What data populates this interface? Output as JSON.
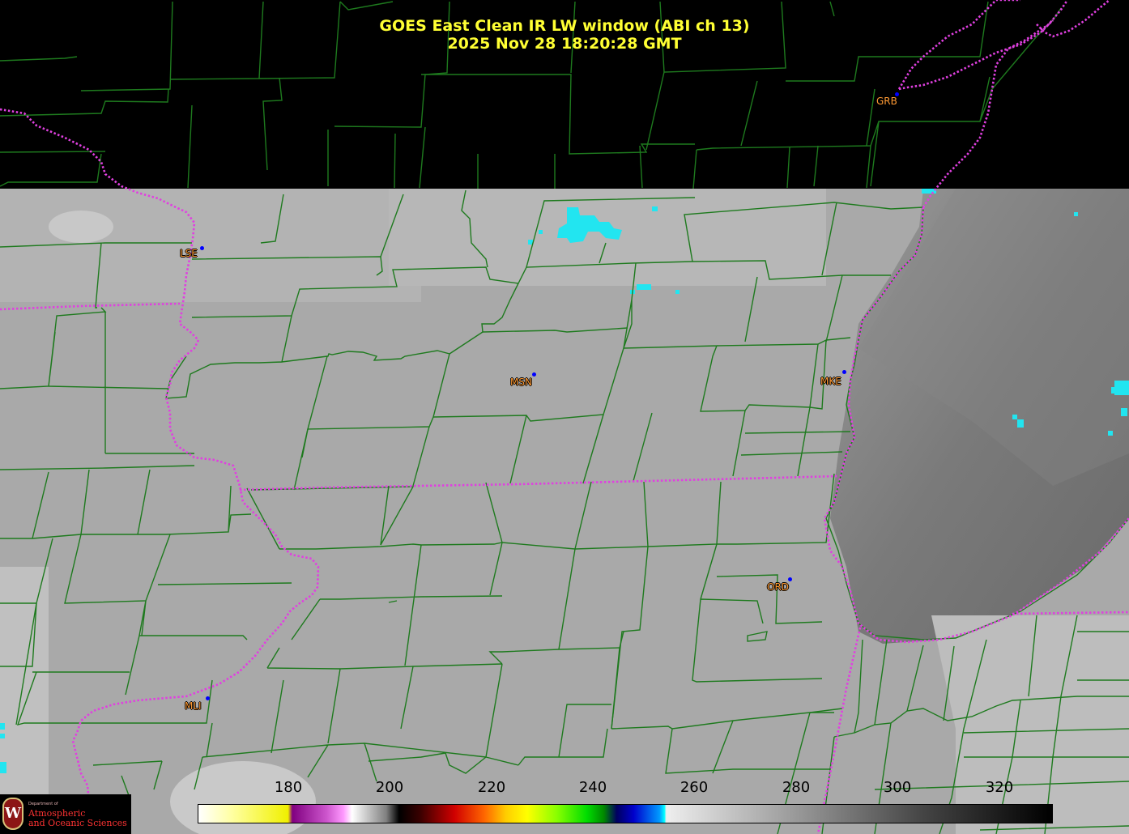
{
  "title": {
    "line1": "GOES East Clean IR LW window (ABI ch 13)",
    "line2": "2025 Nov 28  18:20:28 GMT"
  },
  "cities": [
    {
      "id": "GRB",
      "label": "GRB"
    },
    {
      "id": "LSE",
      "label": "LSE"
    },
    {
      "id": "MSN",
      "label": "MSN"
    },
    {
      "id": "MKE",
      "label": "MKE"
    },
    {
      "id": "ORD",
      "label": "ORD"
    },
    {
      "id": "MLI",
      "label": "MLI"
    }
  ],
  "colorbar": {
    "ticks": [
      "180",
      "200",
      "220",
      "240",
      "260",
      "280",
      "300",
      "320"
    ],
    "range": [
      163,
      330
    ]
  },
  "logo": {
    "small": "Department of",
    "line1": "Atmospheric",
    "line2": "and Oceanic Sciences",
    "mark": "W"
  },
  "colors": {
    "county_lines": "#1e7a1e",
    "state_lines": "#e040e0",
    "title": "#ffff33",
    "city_label": "#ff9a33",
    "cold_cloud": "#22e5f0"
  }
}
